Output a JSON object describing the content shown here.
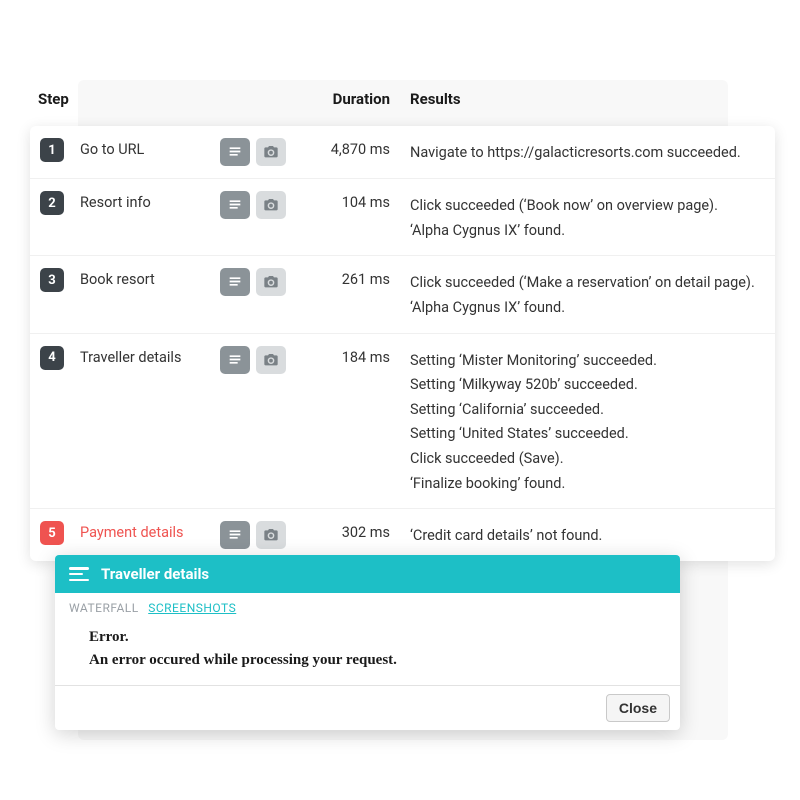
{
  "headers": {
    "step": "Step",
    "duration": "Duration",
    "results": "Results"
  },
  "steps": [
    {
      "num": "1",
      "name": "Go to URL",
      "duration": "4,870 ms",
      "error": false,
      "results": [
        "Navigate to https://galacticresorts.com succeeded."
      ]
    },
    {
      "num": "2",
      "name": "Resort info",
      "duration": "104 ms",
      "error": false,
      "results": [
        "Click succeeded (‘Book now’ on overview page).",
        "‘Alpha Cygnus IX’ found."
      ]
    },
    {
      "num": "3",
      "name": "Book resort",
      "duration": "261 ms",
      "error": false,
      "results": [
        "Click succeeded (‘Make a reservation’ on detail page).",
        "‘Alpha Cygnus IX’ found."
      ]
    },
    {
      "num": "4",
      "name": "Traveller details",
      "duration": "184 ms",
      "error": false,
      "results": [
        "Setting ‘Mister Monitoring’ succeeded.",
        "Setting ‘Milkyway 520b’ succeeded.",
        "Setting ‘California’ succeeded.",
        "Setting ‘United States’ succeeded.",
        "Click succeeded (Save).",
        "‘Finalize booking’ found."
      ]
    },
    {
      "num": "5",
      "name": "Payment details",
      "duration": "302 ms",
      "error": true,
      "results": [
        "‘Credit card details’ not found."
      ]
    }
  ],
  "modal": {
    "title": "Traveller details",
    "tabs": {
      "waterfall": "WATERFALL",
      "screenshots": "SCREENSHOTS"
    },
    "error_title": "Error.",
    "error_msg": "An error occured while processing your request.",
    "close": "Close"
  }
}
